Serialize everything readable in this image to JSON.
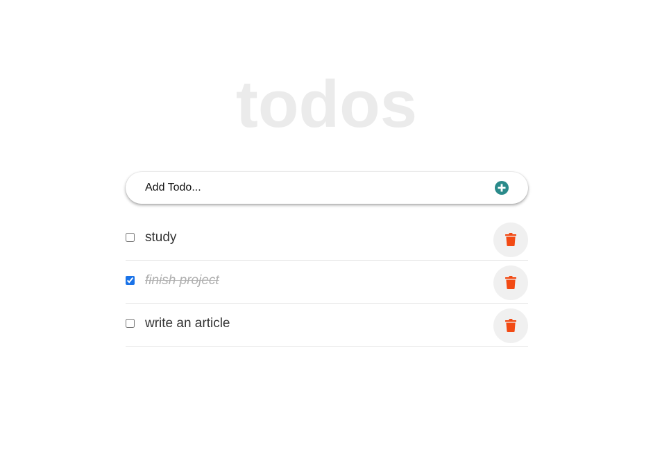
{
  "app": {
    "title": "todos"
  },
  "add_todo": {
    "placeholder": "Add Todo...",
    "button_icon": "plus-circle-icon",
    "accent_color": "#2a8a8a"
  },
  "todos": [
    {
      "label": "study",
      "completed": false
    },
    {
      "label": "finish project",
      "completed": true
    },
    {
      "label": "write an article",
      "completed": false
    }
  ],
  "delete_icon": "trash-icon",
  "delete_color": "#f24a14"
}
